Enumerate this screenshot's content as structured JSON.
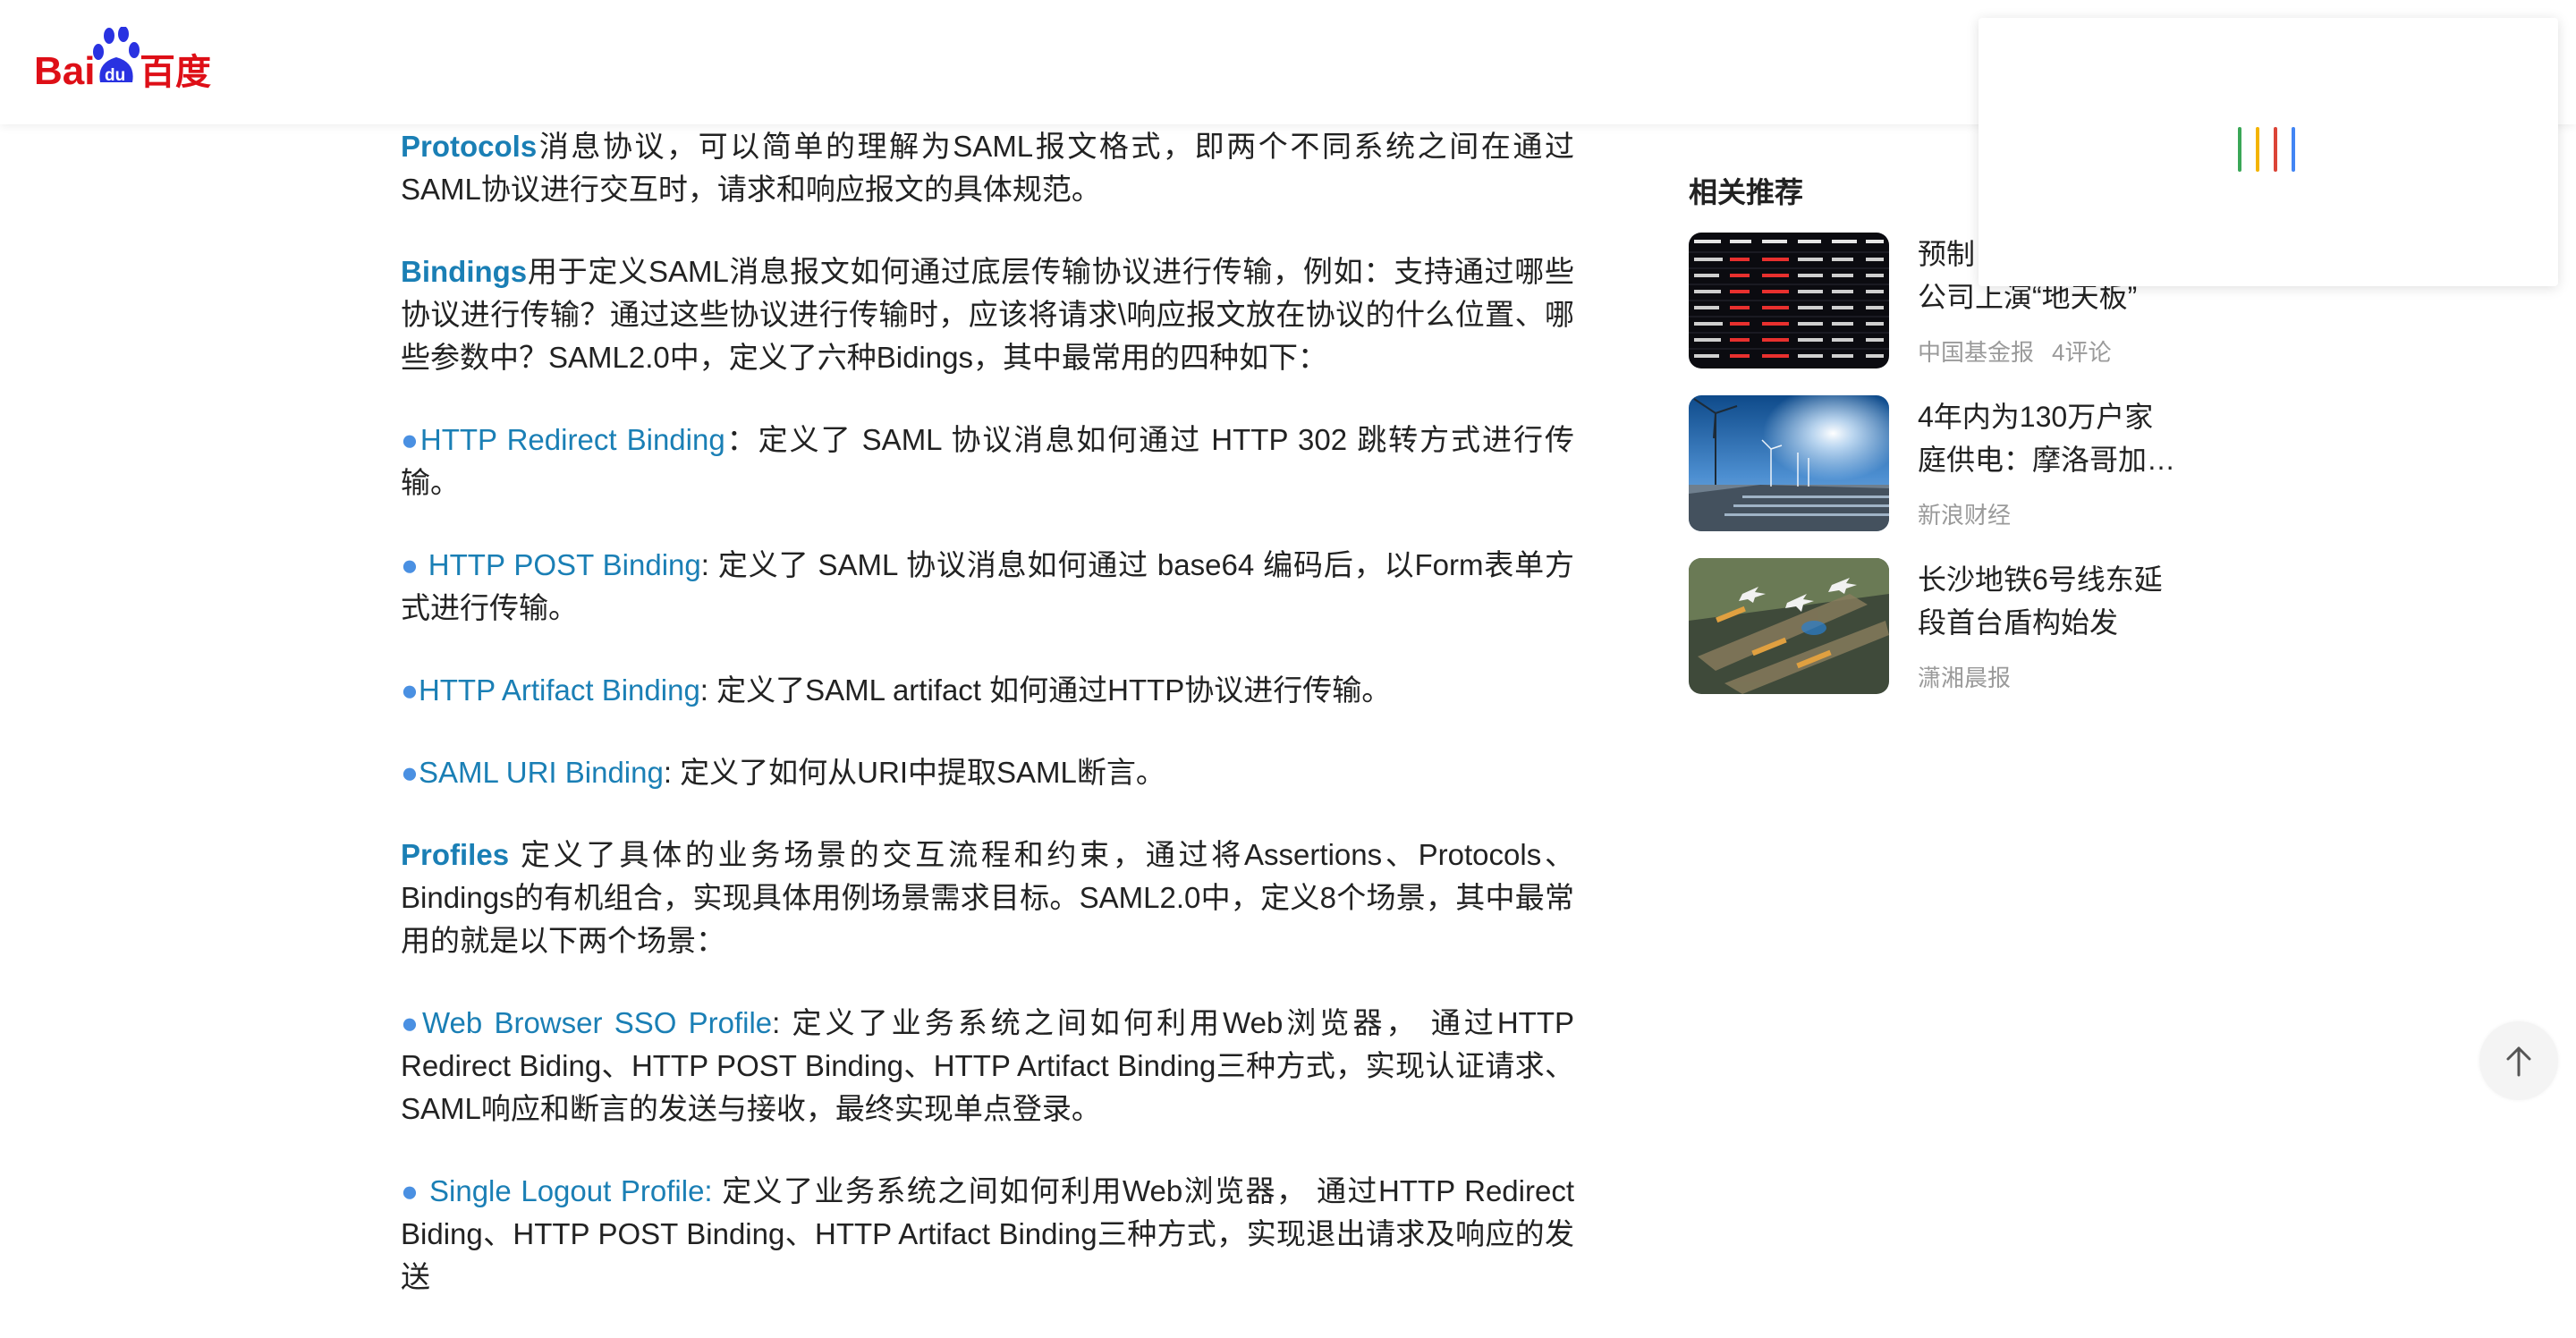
{
  "header": {
    "logo_text": "Baidu百度",
    "logo_bai": "Bai",
    "logo_du": "du",
    "logo_cn": "百度"
  },
  "article": {
    "protocols": {
      "term": "Protocols",
      "text": "消息协议，可以简单的理解为SAML报文格式，即两个不同系统之间在通过SAML协议进行交互时，请求和响应报文的具体规范。"
    },
    "bindings": {
      "term": "Bindings",
      "text": "用于定义SAML消息报文如何通过底层传输协议进行传输，例如：支持通过哪些协议进行传输？通过这些协议进行传输时，应该将请求\\响应报文放在协议的什么位置、哪些参数中？SAML2.0中，定义了六种Bidings，其中最常用的四种如下："
    },
    "binding_items": [
      {
        "bullet": "●",
        "name": "HTTP Redirect Binding",
        "text": "：定义了 SAML 协议消息如何通过 HTTP 302 跳转方式进行传输。"
      },
      {
        "bullet": "● ",
        "name": "HTTP POST Binding",
        "text": ": 定义了 SAML 协议消息如何通过 base64 编码后，以Form表单方式进行传输。"
      },
      {
        "bullet": "●",
        "name": "HTTP Artifact Binding",
        "text": ": 定义了SAML artifact 如何通过HTTP协议进行传输。"
      },
      {
        "bullet": "●",
        "name": "SAML URI Binding",
        "text": ": 定义了如何从URI中提取SAML断言。"
      }
    ],
    "profiles": {
      "term": "Profiles",
      "text": " 定义了具体的业务场景的交互流程和约束，通过将Assertions、Protocols、Bindings的有机组合，实现具体用例场景需求目标。SAML2.0中，定义8个场景，其中最常用的就是以下两个场景："
    },
    "profile_items": [
      {
        "bullet": "●",
        "name": "Web Browser SSO Profile",
        "text": ": 定义了业务系统之间如何利用Web浏览器， 通过HTTP Redirect Biding、HTTP POST Binding、HTTP Artifact Binding三种方式，实现认证请求、SAML响应和断言的发送与接收，最终实现单点登录。"
      },
      {
        "bullet": "● ",
        "name": "Single Logout Profile:",
        "text": " 定义了业务系统之间如何利用Web浏览器， 通过HTTP Redirect Biding、HTTP POST Binding、HTTP Artifact Binding三种方式，实现退出请求及响应的发送"
      }
    ]
  },
  "sidebar": {
    "title": "相关推荐",
    "items": [
      {
        "title": "预制菜公司上演“地天板”",
        "title_visible_line1": "预制",
        "title_visible_line2": "公司上演“地天板”",
        "source": "中国基金报",
        "comments": "4评论"
      },
      {
        "title": "4年内为130万户家庭供电：摩洛哥加…",
        "title_visible_line1": "4年内为130万户家",
        "title_visible_line2": "庭供电：摩洛哥加…",
        "source": "新浪财经",
        "comments": ""
      },
      {
        "title": "长沙地铁6号线东延段首台盾构始发",
        "title_visible_line1": "长沙地铁6号线东延",
        "title_visible_line2": "段首台盾构始发",
        "source": "潇湘晨报",
        "comments": ""
      }
    ]
  },
  "colors": {
    "link": "#1a7fb5",
    "bullet": "#4a90e2",
    "logo_red": "#de0f17",
    "logo_blue": "#2932e1"
  },
  "loading_bar_colors": [
    "#3aa757",
    "#f4b400",
    "#db4437",
    "#4285f4"
  ],
  "back_to_top_icon": "arrow-up-icon"
}
